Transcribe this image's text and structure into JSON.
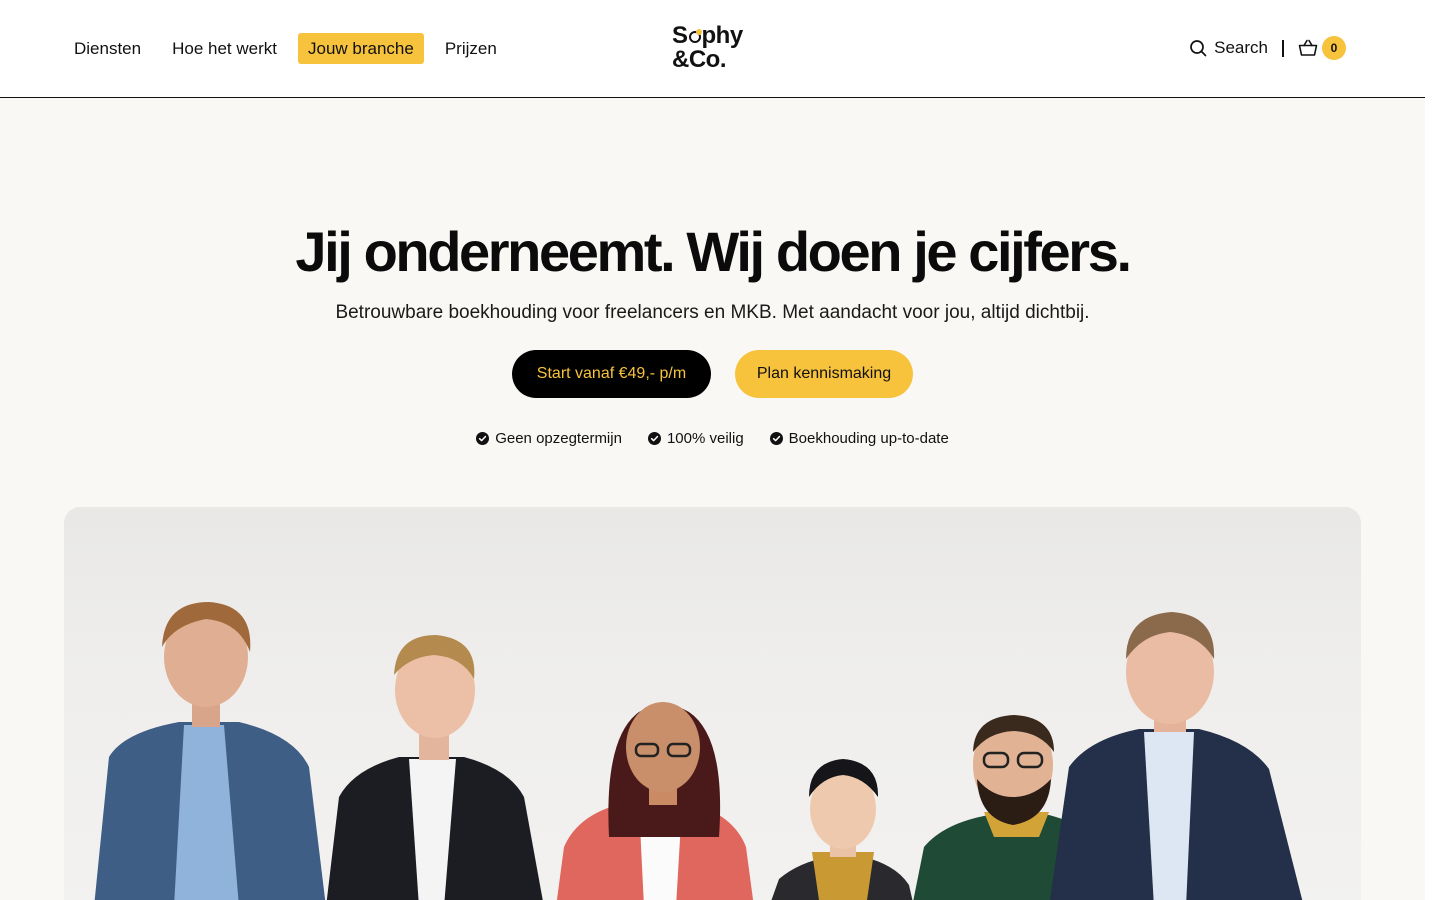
{
  "nav": {
    "items": [
      {
        "label": "Diensten",
        "active": false
      },
      {
        "label": "Hoe het werkt",
        "active": false
      },
      {
        "label": "Jouw branche",
        "active": true
      },
      {
        "label": "Prijzen",
        "active": false
      }
    ]
  },
  "logo": {
    "line1_a": "S",
    "line1_b": "phy",
    "line2": "&Co."
  },
  "header": {
    "search_label": "Search",
    "search_icon": "search-icon",
    "cart_icon": "basket-icon",
    "cart_count": "0"
  },
  "hero": {
    "title": "Jij onderneemt. Wij doen je cijfers.",
    "subtitle": "Betrouwbare boekhouding voor freelancers en MKB. Met aandacht voor jou, altijd dichtbij.",
    "primary_cta": "Start vanaf €49,- p/m",
    "secondary_cta": "Plan kennismaking",
    "usps": [
      "Geen opzegtermijn",
      "100% veilig",
      "Boekhouding up-to-date"
    ]
  },
  "colors": {
    "accent": "#f7c23c",
    "dark": "#000000",
    "background": "#f9f8f5"
  }
}
